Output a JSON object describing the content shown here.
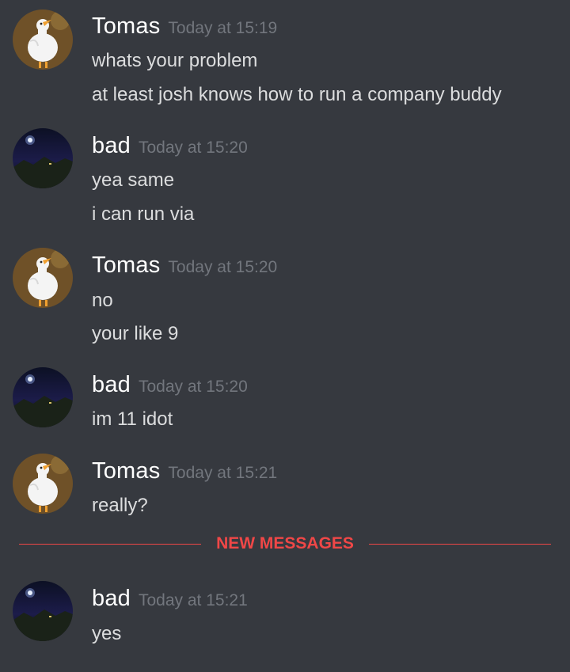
{
  "colors": {
    "background": "#36393f",
    "username": "#ffffff",
    "timestamp": "#72767d",
    "message_text": "#dcddde",
    "new_messages_accent": "#f04747"
  },
  "messages": [
    {
      "author": "Tomas",
      "avatar": "goose-avatar",
      "time": "Today at 15:19",
      "lines": [
        "whats your problem",
        "at least josh knows how to run a company buddy"
      ]
    },
    {
      "author": "bad",
      "avatar": "night-sky-avatar",
      "time": "Today at 15:20",
      "lines": [
        "yea same",
        "i can run via"
      ]
    },
    {
      "author": "Tomas",
      "avatar": "goose-avatar",
      "time": "Today at 15:20",
      "lines": [
        "no",
        "your like 9"
      ]
    },
    {
      "author": "bad",
      "avatar": "night-sky-avatar",
      "time": "Today at 15:20",
      "lines": [
        "im 11 idot"
      ]
    },
    {
      "author": "Tomas",
      "avatar": "goose-avatar",
      "time": "Today at 15:21",
      "lines": [
        "really?"
      ]
    },
    {
      "author": "bad",
      "avatar": "night-sky-avatar",
      "time": "Today at 15:21",
      "lines": [
        "yes"
      ]
    }
  ],
  "new_messages_divider": {
    "label": "NEW MESSAGES"
  }
}
